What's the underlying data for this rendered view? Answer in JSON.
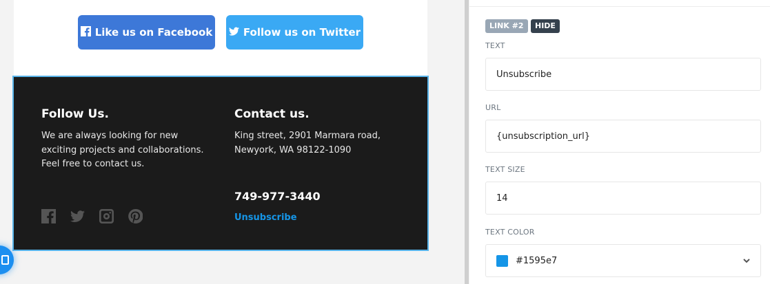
{
  "email": {
    "facebook_button": "Like us on Facebook",
    "twitter_button": "Follow us on Twitter"
  },
  "footer": {
    "follow_title": "Follow Us.",
    "follow_text": "We are always looking for new exciting projects and collaborations. Feel free to contact us.",
    "contact_title": "Contact us.",
    "contact_address": "King street, 2901 Marmara road, Newyork, WA 98122-1090",
    "phone": "749-977-3440",
    "unsubscribe": "Unsubscribe",
    "social_icons": [
      "facebook-icon",
      "twitter-icon",
      "instagram-icon",
      "pinterest-icon"
    ]
  },
  "panel": {
    "link_badge": "LINK #2",
    "hide_badge": "HIDE",
    "text_label": "TEXT",
    "text_value": "Unsubscribe",
    "url_label": "URL",
    "url_value": "{unsubscription_url}",
    "size_label": "TEXT SIZE",
    "size_value": "14",
    "color_label": "TEXT COLOR",
    "color_value": "#1595e7"
  },
  "colors": {
    "link": "#1595e7",
    "facebook": "#3d78d8",
    "twitter": "#3aa9f4",
    "footer_bg": "#1b1b1b",
    "selection_border": "#58b4ea"
  }
}
